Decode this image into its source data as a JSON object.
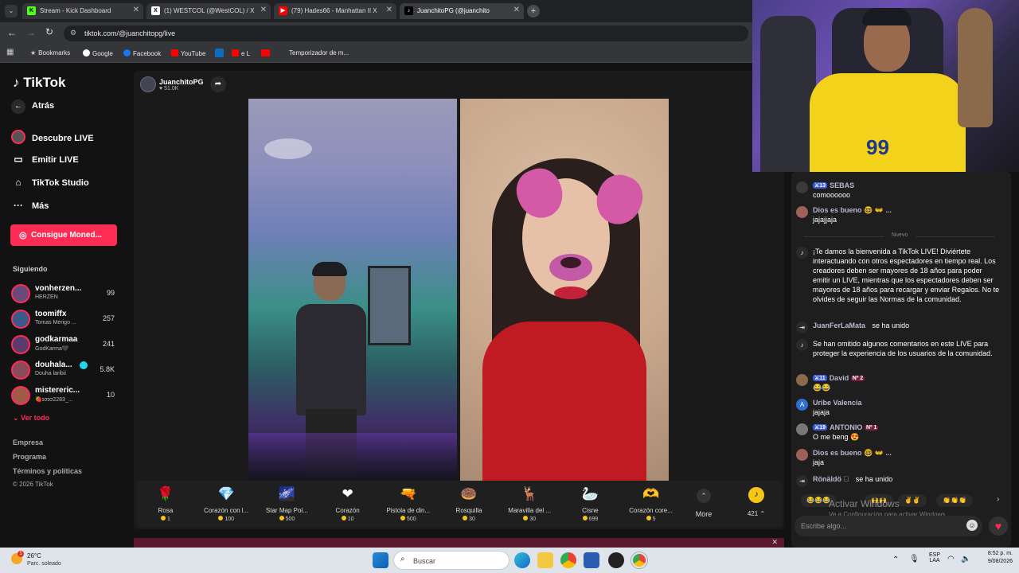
{
  "browser": {
    "tabs": [
      {
        "label": "Stream - Kick Dashboard",
        "fav": "K",
        "color": "#53fc18"
      },
      {
        "label": "(1) WESTCOL (@WestCOL) / X",
        "fav": "X",
        "color": "#000000"
      },
      {
        "label": "(79) Hades66 - Manhattan II X",
        "fav": "▶",
        "color": "#ff0000"
      },
      {
        "label": "JuanchitoPG (@juanchito",
        "fav": "♪",
        "color": "#000000"
      }
    ],
    "url": "tiktok.com/@juanchitopg/live",
    "bookmarks": [
      "Bookmarks",
      "Google",
      "Facebook",
      "YouTube",
      "e L",
      "Temporizador de m..."
    ]
  },
  "sidebar": {
    "logo": "TikTok",
    "back": "Atrás",
    "nav": [
      {
        "label": "Descubre LIVE",
        "icon": "live-icon"
      },
      {
        "label": "Emitir LIVE",
        "icon": "camera-icon"
      },
      {
        "label": "TikTok Studio",
        "icon": "studio-icon"
      },
      {
        "label": "Más",
        "icon": "more-icon"
      }
    ],
    "coins_button": "Consigue Moned...",
    "following_title": "Siguiendo",
    "following": [
      {
        "name": "vonherzen...",
        "sub": "HERZEN",
        "count": "99",
        "color": "#6b4a7a"
      },
      {
        "name": "toomiffx",
        "sub": "Tomas Merigo ...",
        "count": "257",
        "color": "#3b5a8a"
      },
      {
        "name": "godkarmaa",
        "sub": "GodKarma🖤",
        "count": "241",
        "color": "#5a3b6b"
      },
      {
        "name": "douhala...",
        "sub": "Douha laribii",
        "count": "5.8K",
        "color": "#8a4a5a"
      },
      {
        "name": "mistereric...",
        "sub": "🍓ɪσɪσ2283_...",
        "count": "10",
        "color": "#a05a4a"
      }
    ],
    "see_all": "Ver todo",
    "footer": [
      "Empresa",
      "Programa",
      "Términos y políticas",
      "© 2026 TikTok"
    ]
  },
  "stream": {
    "host_name": "JuanchitoPG",
    "host_likes": "51.0K"
  },
  "gifts": [
    {
      "name": "Rosa",
      "price": "1",
      "icon": "🌹"
    },
    {
      "name": "Corazón con l...",
      "price": "100",
      "icon": "💎"
    },
    {
      "name": "Star Map Pol...",
      "price": "500",
      "icon": "🌌"
    },
    {
      "name": "Corazón",
      "price": "10",
      "icon": "❤"
    },
    {
      "name": "Pistola de din...",
      "price": "500",
      "icon": "🔫"
    },
    {
      "name": "Rosquilla",
      "price": "30",
      "icon": "🍩"
    },
    {
      "name": "Maravilla del ...",
      "price": "30",
      "icon": "🦌"
    },
    {
      "name": "Cisne",
      "price": "699",
      "icon": "🦢"
    },
    {
      "name": "Corazón core...",
      "price": "5",
      "icon": "🫶"
    }
  ],
  "gift_more": "More",
  "coin_balance": "421",
  "chat": {
    "messages": [
      {
        "kind": "user",
        "level": "13",
        "user": "SEBAS",
        "text": "comoooooo",
        "color": "#3a3a3a"
      },
      {
        "kind": "user",
        "level": "",
        "user": "Dios es bueno 🤓 👐 ...",
        "text": "jajajjaja",
        "color": "#a0605a"
      },
      {
        "kind": "divider",
        "text": "Nuevo"
      },
      {
        "kind": "system",
        "text": "¡Te damos la bienvenida a TikTok LIVE! Diviértete interactuando con otros espectadores en tiempo real. Los creadores deben ser mayores de 18 años para poder emitir un LIVE, mientras que los espectadores deben ser mayores de 18 años para recargar y enviar Regalos. No te olvides de seguir las Normas de la comunidad."
      },
      {
        "kind": "join",
        "user": "JuanFerLaMata",
        "text": "se ha unido"
      },
      {
        "kind": "system",
        "text": "Se han omitido algunos comentarios en este LIVE para proteger la experiencia de los usuarios de la comunidad."
      },
      {
        "kind": "user",
        "level": "11",
        "user": "David",
        "rank": "Nº 2",
        "text": "😂😂",
        "color": "#8a6a4a"
      },
      {
        "kind": "user",
        "level": "",
        "user": "Uribe Valencia",
        "text": "jajaja",
        "color": "#2f6fd0",
        "initial": "A"
      },
      {
        "kind": "user",
        "level": "19",
        "user": "ANTONIO",
        "rank": "Nº 1",
        "text": "O me beng 😍",
        "color": "#777777"
      },
      {
        "kind": "user",
        "level": "",
        "user": "Dios es bueno 🤓 👐 ...",
        "text": "jaja",
        "color": "#a0605a"
      },
      {
        "kind": "join",
        "user": "Rönäldö 🏻",
        "text": "se ha unido"
      }
    ],
    "input_placeholder": "Escribe algo...",
    "quick_emojis": [
      "😂😂😂",
      "🙌🙌",
      "✌️✌️",
      "👏👏👏"
    ]
  },
  "windows": {
    "activate_title": "Activar Windows",
    "activate_sub": "Ve a Configuración para activar Windows.",
    "weather_temp": "26°C",
    "weather_desc": "Parc. soleado",
    "search": "Buscar",
    "lang": "ESP",
    "lang2": "LAA",
    "time": "8:52 p. m.",
    "date": "9/08/2026"
  }
}
